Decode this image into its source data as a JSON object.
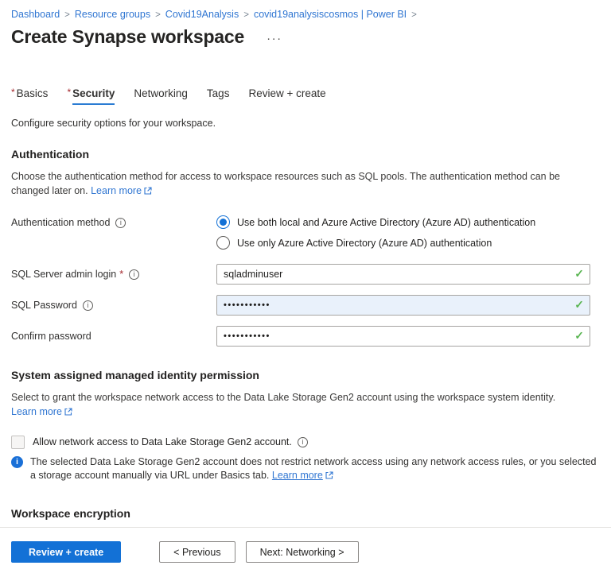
{
  "icons": {
    "required_marker": "*",
    "info_glyph": "i",
    "checkmark": "✓",
    "more_glyph": "···",
    "separator": ">"
  },
  "colors": {
    "primary_button": "#1371d6",
    "link_blue": "#3076d2",
    "valid_green": "#5ab552",
    "required_red": "#a4262c",
    "tab_underline": "#2b7cd3",
    "password_field_highlight": "#e9f1fb"
  },
  "breadcrumb": {
    "separator": ">",
    "items": [
      "Dashboard",
      "Resource groups",
      "Covid19Analysis",
      "covid19analysiscosmos | Power BI"
    ]
  },
  "header": {
    "title": "Create Synapse workspace"
  },
  "tabs": [
    {
      "label": "Basics",
      "required": true,
      "active": false
    },
    {
      "label": "Security",
      "required": true,
      "active": true
    },
    {
      "label": "Networking",
      "required": false,
      "active": false
    },
    {
      "label": "Tags",
      "required": false,
      "active": false
    },
    {
      "label": "Review + create",
      "required": false,
      "active": false
    }
  ],
  "tab_description": "Configure security options for your workspace.",
  "authentication": {
    "heading": "Authentication",
    "description": "Choose the authentication method for access to workspace resources such as SQL pools. The authentication method can be changed later on.",
    "learn_more_label": "Learn more",
    "method_label": "Authentication method",
    "options": [
      {
        "label": "Use both local and Azure Active Directory (Azure AD) authentication",
        "selected": true
      },
      {
        "label": "Use only Azure Active Directory (Azure AD) authentication",
        "selected": false
      }
    ],
    "fields": {
      "admin_login": {
        "label": "SQL Server admin login",
        "value": "sqladminuser",
        "valid": true
      },
      "password": {
        "label": "SQL Password",
        "value": "•••••••••••",
        "valid": true
      },
      "confirm_password": {
        "label": "Confirm password",
        "value": "•••••••••••",
        "valid": true
      }
    }
  },
  "identity": {
    "heading": "System assigned managed identity permission",
    "description": "Select to grant the workspace network access to the Data Lake Storage Gen2 account using the workspace system identity.",
    "learn_more_label": "Learn more",
    "checkbox_label": "Allow network access to Data Lake Storage Gen2 account.",
    "checkbox_checked": false,
    "note": "The selected Data Lake Storage Gen2 account does not restrict network access using any network access rules, or you selected a storage account manually via URL under Basics tab.",
    "note_learn_more_label": "Learn more"
  },
  "encryption": {
    "heading": "Workspace encryption"
  },
  "footer": {
    "review_create_label": "Review + create",
    "previous_label": "< Previous",
    "next_label": "Next: Networking >"
  }
}
